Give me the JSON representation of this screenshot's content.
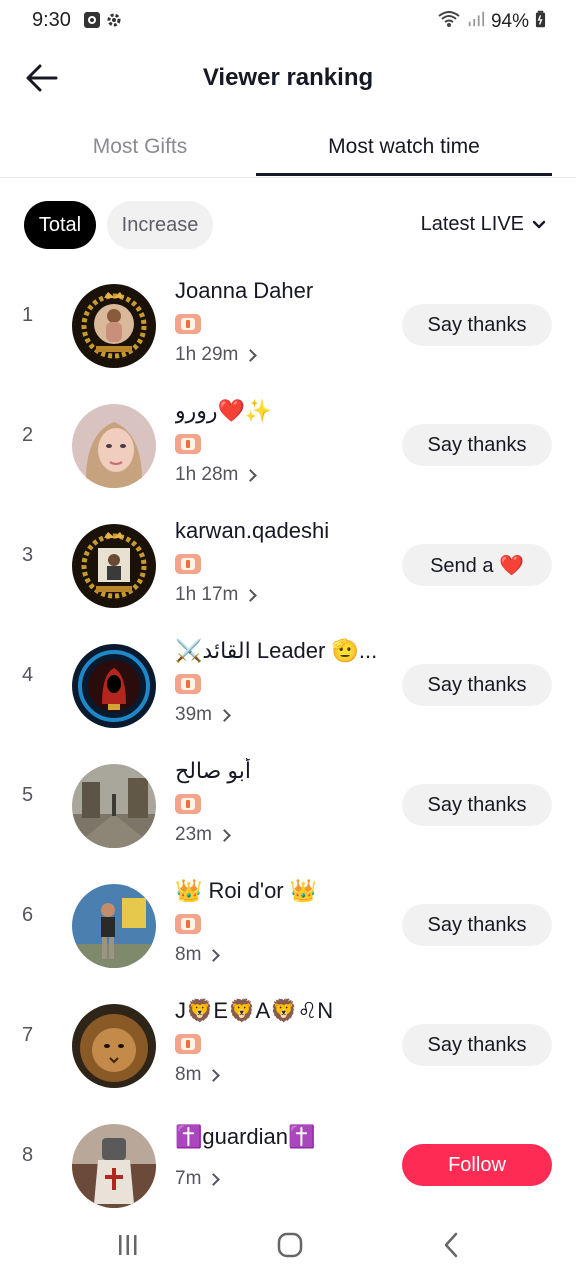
{
  "status_bar": {
    "time": "9:30",
    "battery": "94%"
  },
  "header": {
    "title": "Viewer ranking"
  },
  "tabs": [
    {
      "label": "Most Gifts",
      "active": false
    },
    {
      "label": "Most watch time",
      "active": true
    }
  ],
  "filters": {
    "total": "Total",
    "increase": "Increase",
    "sort": "Latest LIVE"
  },
  "viewers": [
    {
      "rank": "1",
      "name": "Joanna Daher",
      "duration": "1h 29m",
      "action": "Say thanks"
    },
    {
      "rank": "2",
      "name": "رورو❤️✨",
      "duration": "1h 28m",
      "action": "Say thanks"
    },
    {
      "rank": "3",
      "name": "karwan.qadeshi",
      "duration": "1h 17m",
      "action": "Send a ❤️"
    },
    {
      "rank": "4",
      "name": "⚔️القائد Leader 🫡...",
      "duration": "39m",
      "action": "Say thanks"
    },
    {
      "rank": "5",
      "name": "أبو صالح",
      "duration": "23m",
      "action": "Say thanks"
    },
    {
      "rank": "6",
      "name": "👑 Roi d'or 👑",
      "duration": "8m",
      "action": "Say thanks"
    },
    {
      "rank": "7",
      "name": "J🦁E🦁A🦁♌N",
      "duration": "8m",
      "action": "Say thanks"
    },
    {
      "rank": "8",
      "name": "✝️guardian✝️",
      "duration": "7m",
      "action": "Follow"
    }
  ],
  "colors": {
    "accent": "#fe2c55",
    "text": "#161823",
    "muted": "#8a8b91",
    "pill": "#f1f1f2",
    "badge": "#f2a589"
  }
}
